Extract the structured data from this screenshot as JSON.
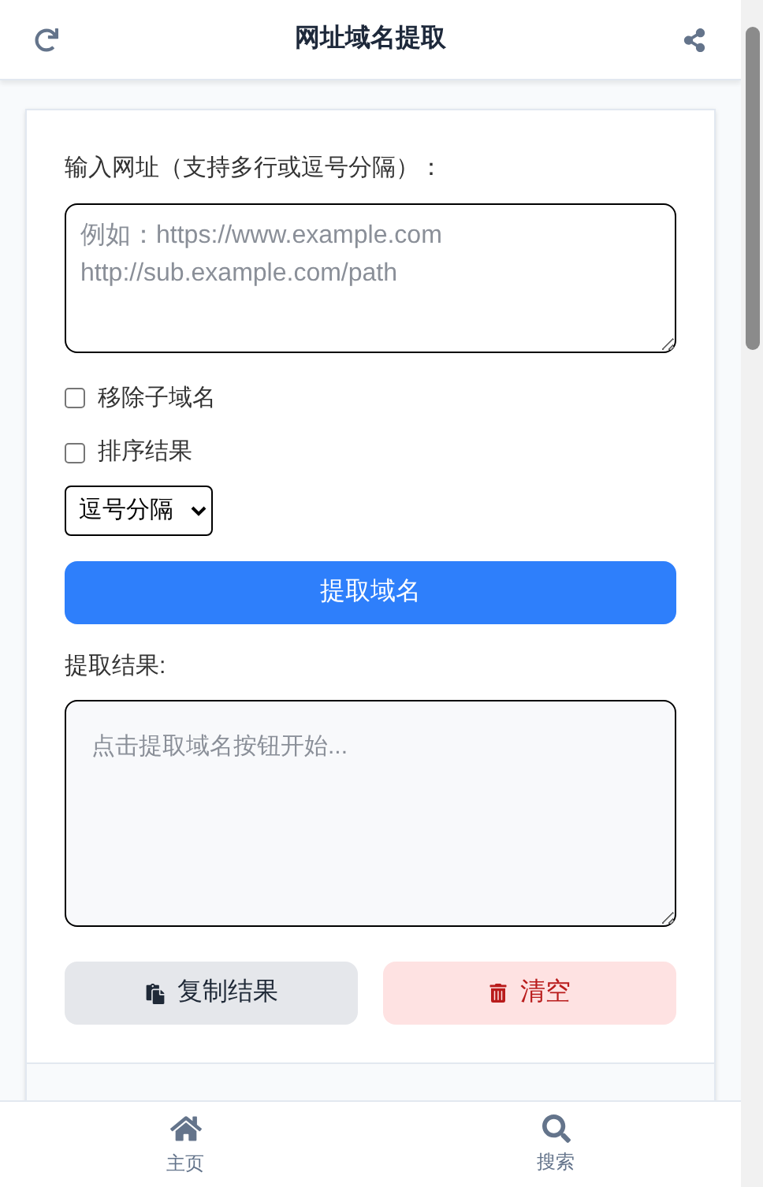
{
  "header": {
    "title": "网址域名提取"
  },
  "input": {
    "label": "输入网址（支持多行或逗号分隔）：",
    "placeholder": "例如：https://www.example.com\nhttp://sub.example.com/path"
  },
  "options": [
    {
      "label": "移除子域名",
      "checked": false
    },
    {
      "label": "排序结果",
      "checked": false
    }
  ],
  "separator": {
    "value": "逗号分隔"
  },
  "extract_button": "提取域名",
  "result": {
    "label": "提取结果:",
    "placeholder": "点击提取域名按钮开始..."
  },
  "actions": [
    {
      "kind": "copy",
      "label": "复制结果"
    },
    {
      "kind": "clear",
      "label": "清空"
    }
  ],
  "bottom_nav": [
    {
      "kind": "home",
      "label": "主页"
    },
    {
      "kind": "search",
      "label": "搜索"
    }
  ]
}
